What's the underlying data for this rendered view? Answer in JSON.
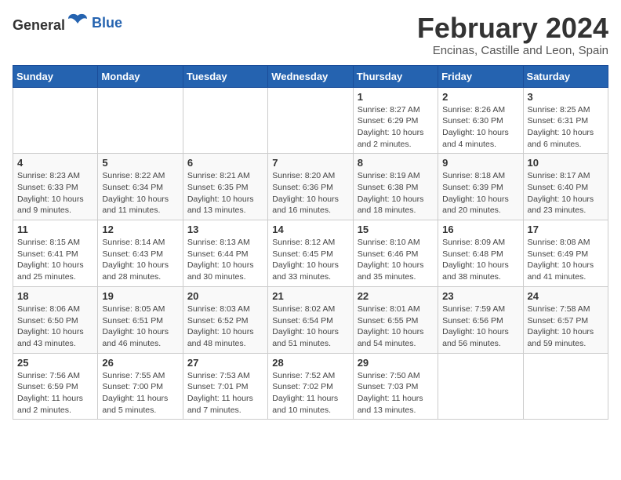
{
  "logo": {
    "text_general": "General",
    "text_blue": "Blue"
  },
  "title": {
    "month_year": "February 2024",
    "location": "Encinas, Castille and Leon, Spain"
  },
  "days_of_week": [
    "Sunday",
    "Monday",
    "Tuesday",
    "Wednesday",
    "Thursday",
    "Friday",
    "Saturday"
  ],
  "weeks": [
    [
      {
        "day": "",
        "info": ""
      },
      {
        "day": "",
        "info": ""
      },
      {
        "day": "",
        "info": ""
      },
      {
        "day": "",
        "info": ""
      },
      {
        "day": "1",
        "info": "Sunrise: 8:27 AM\nSunset: 6:29 PM\nDaylight: 10 hours\nand 2 minutes."
      },
      {
        "day": "2",
        "info": "Sunrise: 8:26 AM\nSunset: 6:30 PM\nDaylight: 10 hours\nand 4 minutes."
      },
      {
        "day": "3",
        "info": "Sunrise: 8:25 AM\nSunset: 6:31 PM\nDaylight: 10 hours\nand 6 minutes."
      }
    ],
    [
      {
        "day": "4",
        "info": "Sunrise: 8:23 AM\nSunset: 6:33 PM\nDaylight: 10 hours\nand 9 minutes."
      },
      {
        "day": "5",
        "info": "Sunrise: 8:22 AM\nSunset: 6:34 PM\nDaylight: 10 hours\nand 11 minutes."
      },
      {
        "day": "6",
        "info": "Sunrise: 8:21 AM\nSunset: 6:35 PM\nDaylight: 10 hours\nand 13 minutes."
      },
      {
        "day": "7",
        "info": "Sunrise: 8:20 AM\nSunset: 6:36 PM\nDaylight: 10 hours\nand 16 minutes."
      },
      {
        "day": "8",
        "info": "Sunrise: 8:19 AM\nSunset: 6:38 PM\nDaylight: 10 hours\nand 18 minutes."
      },
      {
        "day": "9",
        "info": "Sunrise: 8:18 AM\nSunset: 6:39 PM\nDaylight: 10 hours\nand 20 minutes."
      },
      {
        "day": "10",
        "info": "Sunrise: 8:17 AM\nSunset: 6:40 PM\nDaylight: 10 hours\nand 23 minutes."
      }
    ],
    [
      {
        "day": "11",
        "info": "Sunrise: 8:15 AM\nSunset: 6:41 PM\nDaylight: 10 hours\nand 25 minutes."
      },
      {
        "day": "12",
        "info": "Sunrise: 8:14 AM\nSunset: 6:43 PM\nDaylight: 10 hours\nand 28 minutes."
      },
      {
        "day": "13",
        "info": "Sunrise: 8:13 AM\nSunset: 6:44 PM\nDaylight: 10 hours\nand 30 minutes."
      },
      {
        "day": "14",
        "info": "Sunrise: 8:12 AM\nSunset: 6:45 PM\nDaylight: 10 hours\nand 33 minutes."
      },
      {
        "day": "15",
        "info": "Sunrise: 8:10 AM\nSunset: 6:46 PM\nDaylight: 10 hours\nand 35 minutes."
      },
      {
        "day": "16",
        "info": "Sunrise: 8:09 AM\nSunset: 6:48 PM\nDaylight: 10 hours\nand 38 minutes."
      },
      {
        "day": "17",
        "info": "Sunrise: 8:08 AM\nSunset: 6:49 PM\nDaylight: 10 hours\nand 41 minutes."
      }
    ],
    [
      {
        "day": "18",
        "info": "Sunrise: 8:06 AM\nSunset: 6:50 PM\nDaylight: 10 hours\nand 43 minutes."
      },
      {
        "day": "19",
        "info": "Sunrise: 8:05 AM\nSunset: 6:51 PM\nDaylight: 10 hours\nand 46 minutes."
      },
      {
        "day": "20",
        "info": "Sunrise: 8:03 AM\nSunset: 6:52 PM\nDaylight: 10 hours\nand 48 minutes."
      },
      {
        "day": "21",
        "info": "Sunrise: 8:02 AM\nSunset: 6:54 PM\nDaylight: 10 hours\nand 51 minutes."
      },
      {
        "day": "22",
        "info": "Sunrise: 8:01 AM\nSunset: 6:55 PM\nDaylight: 10 hours\nand 54 minutes."
      },
      {
        "day": "23",
        "info": "Sunrise: 7:59 AM\nSunset: 6:56 PM\nDaylight: 10 hours\nand 56 minutes."
      },
      {
        "day": "24",
        "info": "Sunrise: 7:58 AM\nSunset: 6:57 PM\nDaylight: 10 hours\nand 59 minutes."
      }
    ],
    [
      {
        "day": "25",
        "info": "Sunrise: 7:56 AM\nSunset: 6:59 PM\nDaylight: 11 hours\nand 2 minutes."
      },
      {
        "day": "26",
        "info": "Sunrise: 7:55 AM\nSunset: 7:00 PM\nDaylight: 11 hours\nand 5 minutes."
      },
      {
        "day": "27",
        "info": "Sunrise: 7:53 AM\nSunset: 7:01 PM\nDaylight: 11 hours\nand 7 minutes."
      },
      {
        "day": "28",
        "info": "Sunrise: 7:52 AM\nSunset: 7:02 PM\nDaylight: 11 hours\nand 10 minutes."
      },
      {
        "day": "29",
        "info": "Sunrise: 7:50 AM\nSunset: 7:03 PM\nDaylight: 11 hours\nand 13 minutes."
      },
      {
        "day": "",
        "info": ""
      },
      {
        "day": "",
        "info": ""
      }
    ]
  ]
}
